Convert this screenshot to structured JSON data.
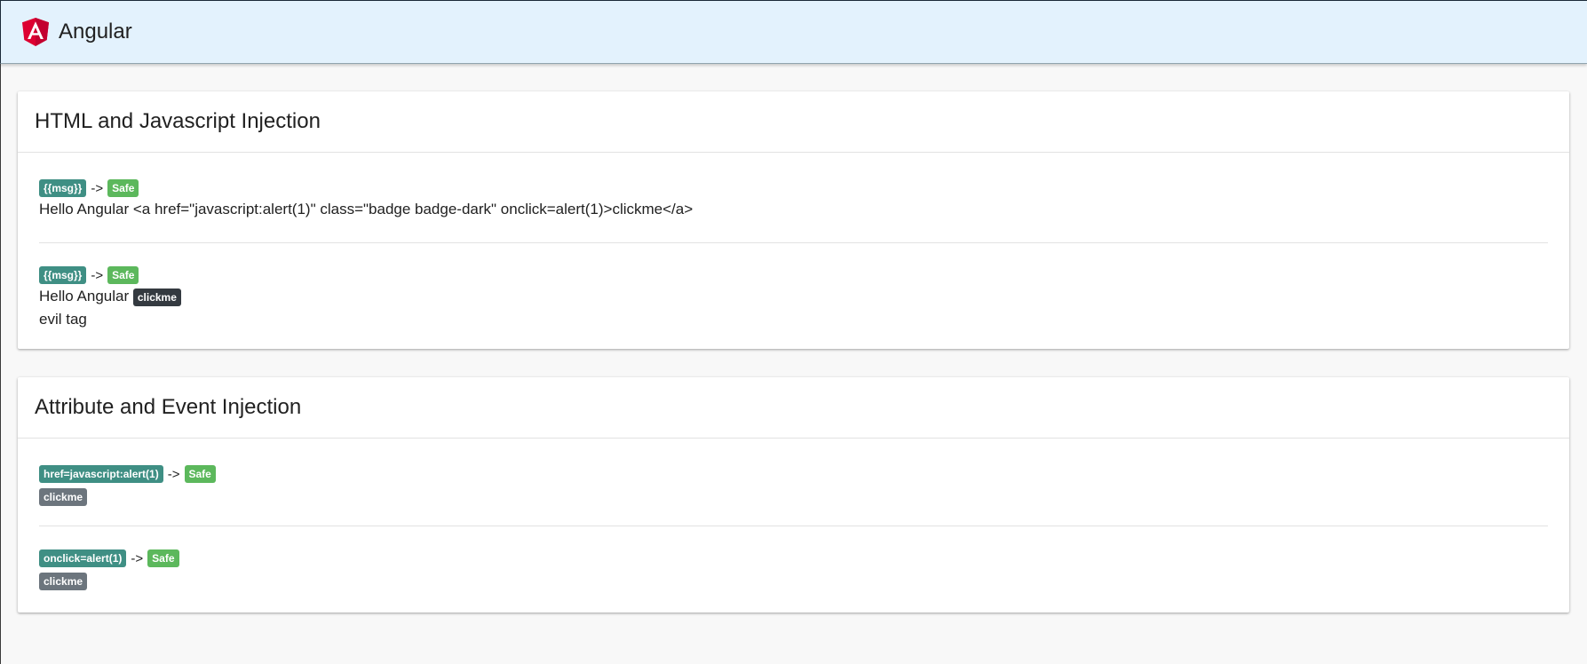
{
  "toolbar": {
    "title": "Angular",
    "logo_icon": "angular-logo-icon",
    "logo_letter": "A",
    "background": "#e3f2fd"
  },
  "cards": [
    {
      "title": "HTML and Javascript Injection",
      "items": [
        {
          "source_badge": "{{msg}}",
          "arrow": "->",
          "status_badge": "Safe",
          "output_text": "Hello Angular <a href=\"javascript:alert(1)\" class=\"badge badge-dark\" onclick=alert(1)>clickme</a>"
        },
        {
          "source_badge": "{{msg}}",
          "arrow": "->",
          "status_badge": "Safe",
          "output_text": "Hello Angular",
          "output_link": "clickme",
          "output_line2": "evil tag"
        }
      ]
    },
    {
      "title": "Attribute and Event Injection",
      "items": [
        {
          "source_badge": "href=javascript:alert(1)",
          "arrow": "->",
          "status_badge": "Safe",
          "output_link": "clickme"
        },
        {
          "source_badge": "onclick=alert(1)",
          "arrow": "->",
          "status_badge": "Safe",
          "output_link": "clickme"
        }
      ]
    }
  ],
  "colors": {
    "source_badge": "#3f8f84",
    "safe_badge": "#5cb85c",
    "dark_badge": "#343a40",
    "gray_badge": "#6c757d"
  }
}
